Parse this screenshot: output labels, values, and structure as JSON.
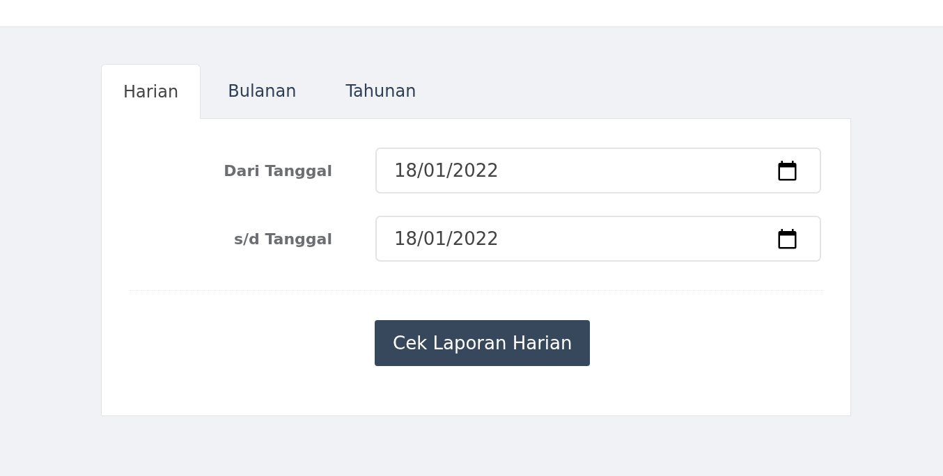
{
  "tabs": [
    {
      "label": "Harian",
      "selected": true
    },
    {
      "label": "Bulanan",
      "selected": false
    },
    {
      "label": "Tahunan",
      "selected": false
    }
  ],
  "form": {
    "fields": [
      {
        "label": "Dari Tanggal",
        "value": "18/01/2022"
      },
      {
        "label": "s/d Tanggal",
        "value": "18/01/2022"
      }
    ],
    "submit_button": "Cek Laporan Harian"
  }
}
